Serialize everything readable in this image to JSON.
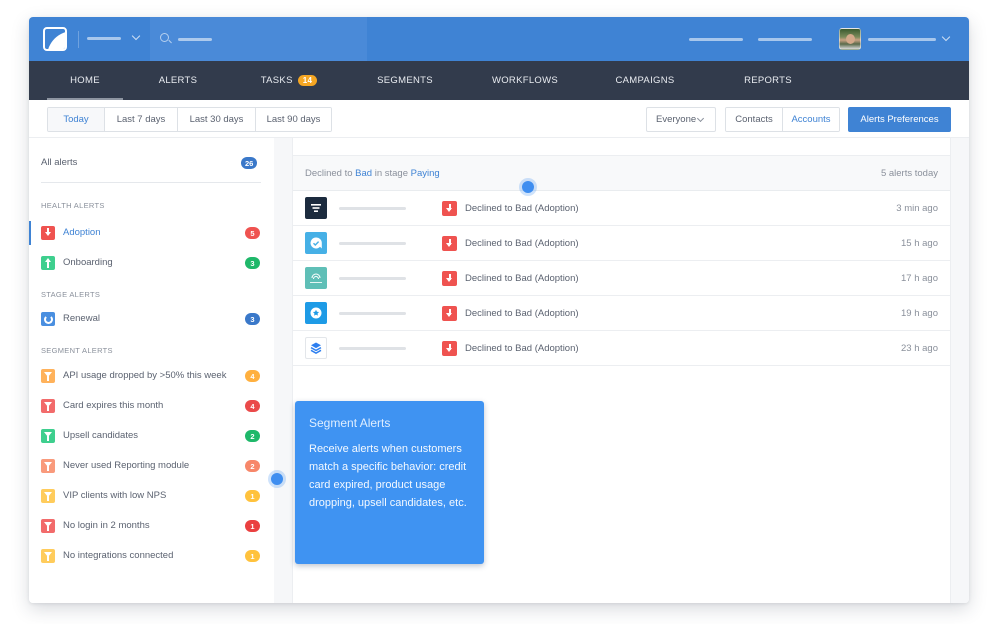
{
  "colors": {
    "brand": "#3f83d4",
    "nav_bg": "#323b4c",
    "red": "#ef5350",
    "green": "#2ecc71",
    "orange": "#f5a623",
    "blue": "#3f83d4",
    "salmon": "#f7876a",
    "yellow": "#ffc94a"
  },
  "header": {
    "logo_icon": "app-logo-icon",
    "account_icon": "chevron-down-icon",
    "search_icon": "search-icon",
    "search_placeholder": "",
    "profile_icon": "chevron-down-icon"
  },
  "nav": {
    "items": [
      {
        "label": "HOME",
        "active": true
      },
      {
        "label": "ALERTS"
      },
      {
        "label": "TASKS",
        "badge": "14"
      },
      {
        "label": "SEGMENTS"
      },
      {
        "label": "WORKFLOWS"
      },
      {
        "label": "CAMPAIGNS"
      },
      {
        "label": "REPORTS"
      }
    ]
  },
  "toolbar": {
    "date_ranges": [
      "Today",
      "Last 7 days",
      "Last 30 days",
      "Last 90 days"
    ],
    "active_date_range": "Today",
    "audience_select": "Everyone",
    "entity_toggle": [
      "Contacts",
      "Accounts"
    ],
    "active_entity": "Accounts",
    "preferences_button": "Alerts Preferences"
  },
  "sidebar": {
    "all_alerts": {
      "label": "All alerts",
      "count": "26"
    },
    "sections": [
      {
        "heading": "HEALTH ALERTS",
        "items": [
          {
            "label": "Adoption",
            "count": "5",
            "icon": "arrow-down-icon",
            "color": "#ef5350",
            "count_color": "#ef5350",
            "active": true
          },
          {
            "label": "Onboarding",
            "count": "3",
            "icon": "arrow-up-icon",
            "color": "#3ecf8e",
            "count_color": "#1fb86a"
          }
        ]
      },
      {
        "heading": "STAGE ALERTS",
        "items": [
          {
            "label": "Renewal",
            "count": "3",
            "icon": "renewal-icon",
            "color": "#4a8fe0",
            "count_color": "#3a78c9"
          }
        ]
      },
      {
        "heading": "SEGMENT ALERTS",
        "items": [
          {
            "label": "API usage dropped by >50% this week",
            "count": "4",
            "icon": "funnel-icon",
            "color": "#ffb25b",
            "count_color": "#ffb03f"
          },
          {
            "label": "Card expires this month",
            "count": "4",
            "icon": "funnel-icon",
            "color": "#f26b6b",
            "count_color": "#ea4a4a"
          },
          {
            "label": "Upsell candidates",
            "count": "2",
            "icon": "funnel-icon",
            "color": "#3ecf8e",
            "count_color": "#1fb86a"
          },
          {
            "label": "Never used Reporting module",
            "count": "2",
            "icon": "funnel-icon",
            "color": "#f99a7c",
            "count_color": "#f7876a"
          },
          {
            "label": "VIP clients with low NPS",
            "count": "1",
            "icon": "funnel-icon",
            "color": "#ffcc5c",
            "count_color": "#ffc23d"
          },
          {
            "label": "No login in 2 months",
            "count": "1",
            "icon": "funnel-icon",
            "color": "#f26b6b",
            "count_color": "#ea4040"
          },
          {
            "label": "No integrations connected",
            "count": "1",
            "icon": "funnel-icon",
            "color": "#ffcc5c",
            "count_color": "#ffc23d"
          }
        ]
      }
    ]
  },
  "alerts_panel": {
    "title_prefix": "Declined to ",
    "title_state": "Bad",
    "title_middle": " in stage ",
    "title_stage": "Paying",
    "summary": "5 alerts today",
    "rows": [
      {
        "logo": "filter-logo-icon",
        "logo_color": "#1c2b3e",
        "alert": "Declined to Bad (Adoption)",
        "time": "3 min ago"
      },
      {
        "logo": "chat-check-logo-icon",
        "logo_color": "#46b0e6",
        "alert": "Declined to Bad (Adoption)",
        "time": "15 h ago"
      },
      {
        "logo": "zenchef-logo-icon",
        "logo_color": "#5fbfb7",
        "alert": "Declined to Bad (Adoption)",
        "time": "17 h ago"
      },
      {
        "logo": "star-badge-logo-icon",
        "logo_color": "#1e9be6",
        "alert": "Declined to Bad (Adoption)",
        "time": "19 h ago"
      },
      {
        "logo": "layers-logo-icon",
        "logo_color": "#ffffff",
        "alert": "Declined to Bad (Adoption)",
        "time": "23 h ago"
      }
    ]
  },
  "tooltip": {
    "title": "Segment Alerts",
    "body": "Receive alerts when customers match a specific behavior: credit card expired, product usage dropping, upsell candidates, etc."
  }
}
